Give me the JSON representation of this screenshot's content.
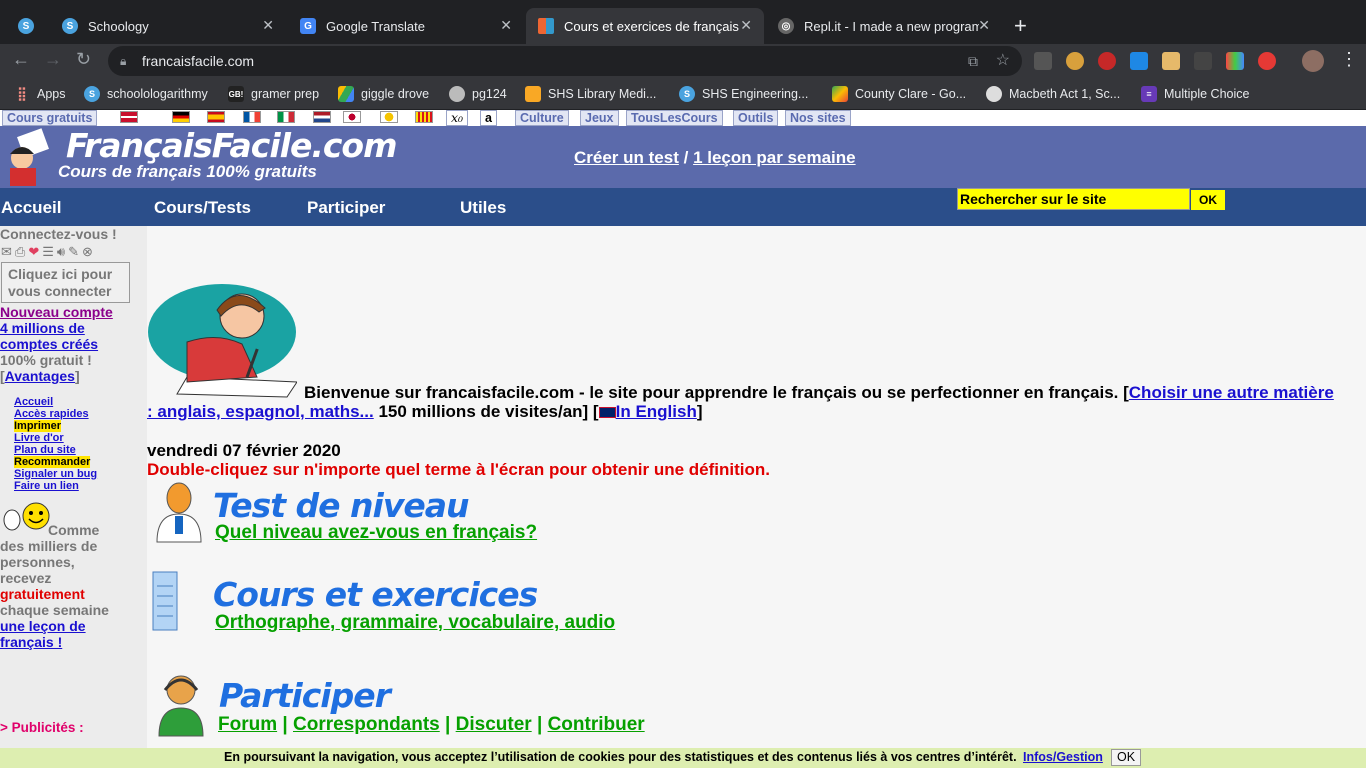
{
  "tabs": [
    {
      "title": "",
      "favicon": "S"
    },
    {
      "title": "Schoology",
      "favicon": "S"
    },
    {
      "title": "Google Translate",
      "favicon": "G"
    },
    {
      "title": "Cours et exercices de français",
      "favicon": "F"
    },
    {
      "title": "Repl.it - I made a new program",
      "favicon": "R"
    }
  ],
  "omnibox": {
    "url": "francaisfacile.com"
  },
  "bookmarks": [
    {
      "label": "Apps",
      "icon": "apps-grid-icon"
    },
    {
      "label": "schoolologarithmy",
      "icon": "schoology-icon"
    },
    {
      "label": "gramer prep",
      "icon": "gb-icon"
    },
    {
      "label": "giggle drove",
      "icon": "drive-icon"
    },
    {
      "label": "pg124",
      "icon": "globe-icon"
    },
    {
      "label": "SHS Library Medi...",
      "icon": "library-icon"
    },
    {
      "label": "SHS Engineering...",
      "icon": "schoology-icon"
    },
    {
      "label": "County Clare - Go...",
      "icon": "maps-icon"
    },
    {
      "label": "Macbeth Act 1, Sc...",
      "icon": "macbeth-icon"
    },
    {
      "label": "Multiple Choice",
      "icon": "form-icon"
    }
  ],
  "topmenu": {
    "cours_gratuits": "Cours gratuits",
    "x0": "x₀",
    "a": "a",
    "culture": "Culture",
    "jeux": "Jeux",
    "touslescours": "TousLesCours",
    "outils": "Outils",
    "nos_sites": "Nos sites"
  },
  "header": {
    "title": "FrançaisFacile.com",
    "subtitle": "Cours de français 100% gratuits",
    "link1": "Créer un test",
    "sep": "/",
    "link2": "1 leçon par semaine"
  },
  "mainnav": {
    "items": [
      "Accueil",
      "Cours/Tests",
      "Participer",
      "Utiles"
    ],
    "search_placeholder": "Rechercher sur le site",
    "ok": "OK"
  },
  "sidebar": {
    "connect": "Connectez-vous !",
    "connect_button": "Cliquez ici pour vous connecter",
    "new_account": "Nouveau compte",
    "millions": "4 millions de comptes créés",
    "free": "100% gratuit !",
    "advantages_open": "[",
    "advantages": "Avantages",
    "advantages_close": "]",
    "links": [
      "Accueil",
      "Accès rapides",
      "Imprimer",
      "Livre d'or",
      "Plan du site",
      "Recommander",
      "Signaler un bug",
      "Faire un lien"
    ],
    "promo_1": "Comme des milliers de personnes, recevez",
    "promo_2": "gratuitement",
    "promo_3": "chaque semaine",
    "promo_4": "une leçon de français !",
    "ads": "> Publicités :"
  },
  "content": {
    "welcome": "Bienvenue sur francaisfacile.com - le site pour apprendre le français ou se perfectionner en français. [",
    "choose_subject": "Choisir une autre matière : anglais, espagnol, maths...",
    "visits": " 150 millions de visites/an] [",
    "in_english": "In English",
    "close_bracket": "]",
    "date": "vendredi 07 février 2020",
    "dblclick": "Double-cliquez sur n'importe quel terme à l'écran pour obtenir une définition.",
    "test_title": "Test de niveau",
    "test_link": "Quel niveau avez-vous en français?",
    "cours_title": "Cours et exercices",
    "cours_link": "Orthographe, grammaire, vocabulaire, audio",
    "participer_title": "Participer",
    "forum": "Forum",
    "correspondants": "Correspondants",
    "discuter": "Discuter",
    "contribuer": "Contribuer",
    "pipe": "|"
  },
  "cookie": {
    "text": "En poursuivant la navigation, vous acceptez l’utilisation de cookies pour des statistiques et des contenus liés à vos centres d’intérêt.",
    "link": "Infos/Gestion",
    "ok": "OK"
  }
}
